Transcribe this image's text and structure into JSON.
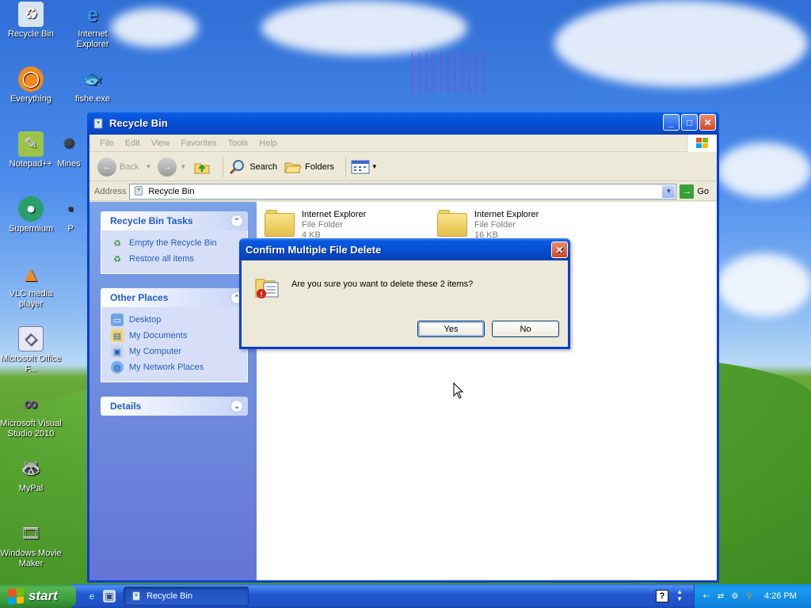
{
  "desktop": {
    "icons": [
      {
        "label": "Recycle Bin",
        "icon": "recycle-bin-icon"
      },
      {
        "label": "Internet Explorer",
        "icon": "internet-explorer-icon"
      },
      {
        "label": "Everything",
        "icon": "everything-icon"
      },
      {
        "label": "fishe.exe",
        "icon": "fishe-exe-icon"
      },
      {
        "label": "Notepad++",
        "icon": "notepad-plus-plus-icon"
      },
      {
        "label": "Mines",
        "icon": "minesweeper-icon"
      },
      {
        "label": "Supermium",
        "icon": "supermium-icon"
      },
      {
        "label": "P",
        "icon": "program-icon"
      },
      {
        "label": "VLC media player",
        "icon": "vlc-icon"
      },
      {
        "label": "Microsoft Office F...",
        "icon": "microsoft-office-icon"
      },
      {
        "label": "Microsoft Visual Studio 2010",
        "icon": "visual-studio-icon"
      },
      {
        "label": "MyPal",
        "icon": "mypal-icon"
      },
      {
        "label": "Windows Movie Maker",
        "icon": "movie-maker-icon"
      }
    ]
  },
  "window": {
    "title": "Recycle Bin",
    "menu": [
      "File",
      "Edit",
      "View",
      "Favorites",
      "Tools",
      "Help"
    ],
    "toolbar": {
      "back_label": "Back",
      "search_label": "Search",
      "folders_label": "Folders"
    },
    "address": {
      "label": "Address",
      "value": "Recycle Bin",
      "go_label": "Go"
    },
    "tasks_panel": {
      "title": "Recycle Bin Tasks",
      "items": [
        "Empty the Recycle Bin",
        "Restore all items"
      ]
    },
    "places_panel": {
      "title": "Other Places",
      "items": [
        "Desktop",
        "My Documents",
        "My Computer",
        "My Network Places"
      ]
    },
    "details_panel": {
      "title": "Details"
    },
    "files": [
      {
        "name": "Internet Explorer",
        "type": "File Folder",
        "size": "4 KB"
      },
      {
        "name": "Internet Explorer",
        "type": "File Folder",
        "size": "16 KB"
      }
    ]
  },
  "dialog": {
    "title": "Confirm Multiple File Delete",
    "message": "Are you sure you want to delete these 2 items?",
    "yes_label": "Yes",
    "no_label": "No"
  },
  "taskbar": {
    "start_label": "start",
    "task_label": "Recycle Bin",
    "clock": "4:26 PM"
  },
  "colors": {
    "titlebar_blue": "#0450d6",
    "taskbar_blue": "#2459d3",
    "start_green": "#3a9a3a",
    "panel_link": "#215dc6"
  }
}
